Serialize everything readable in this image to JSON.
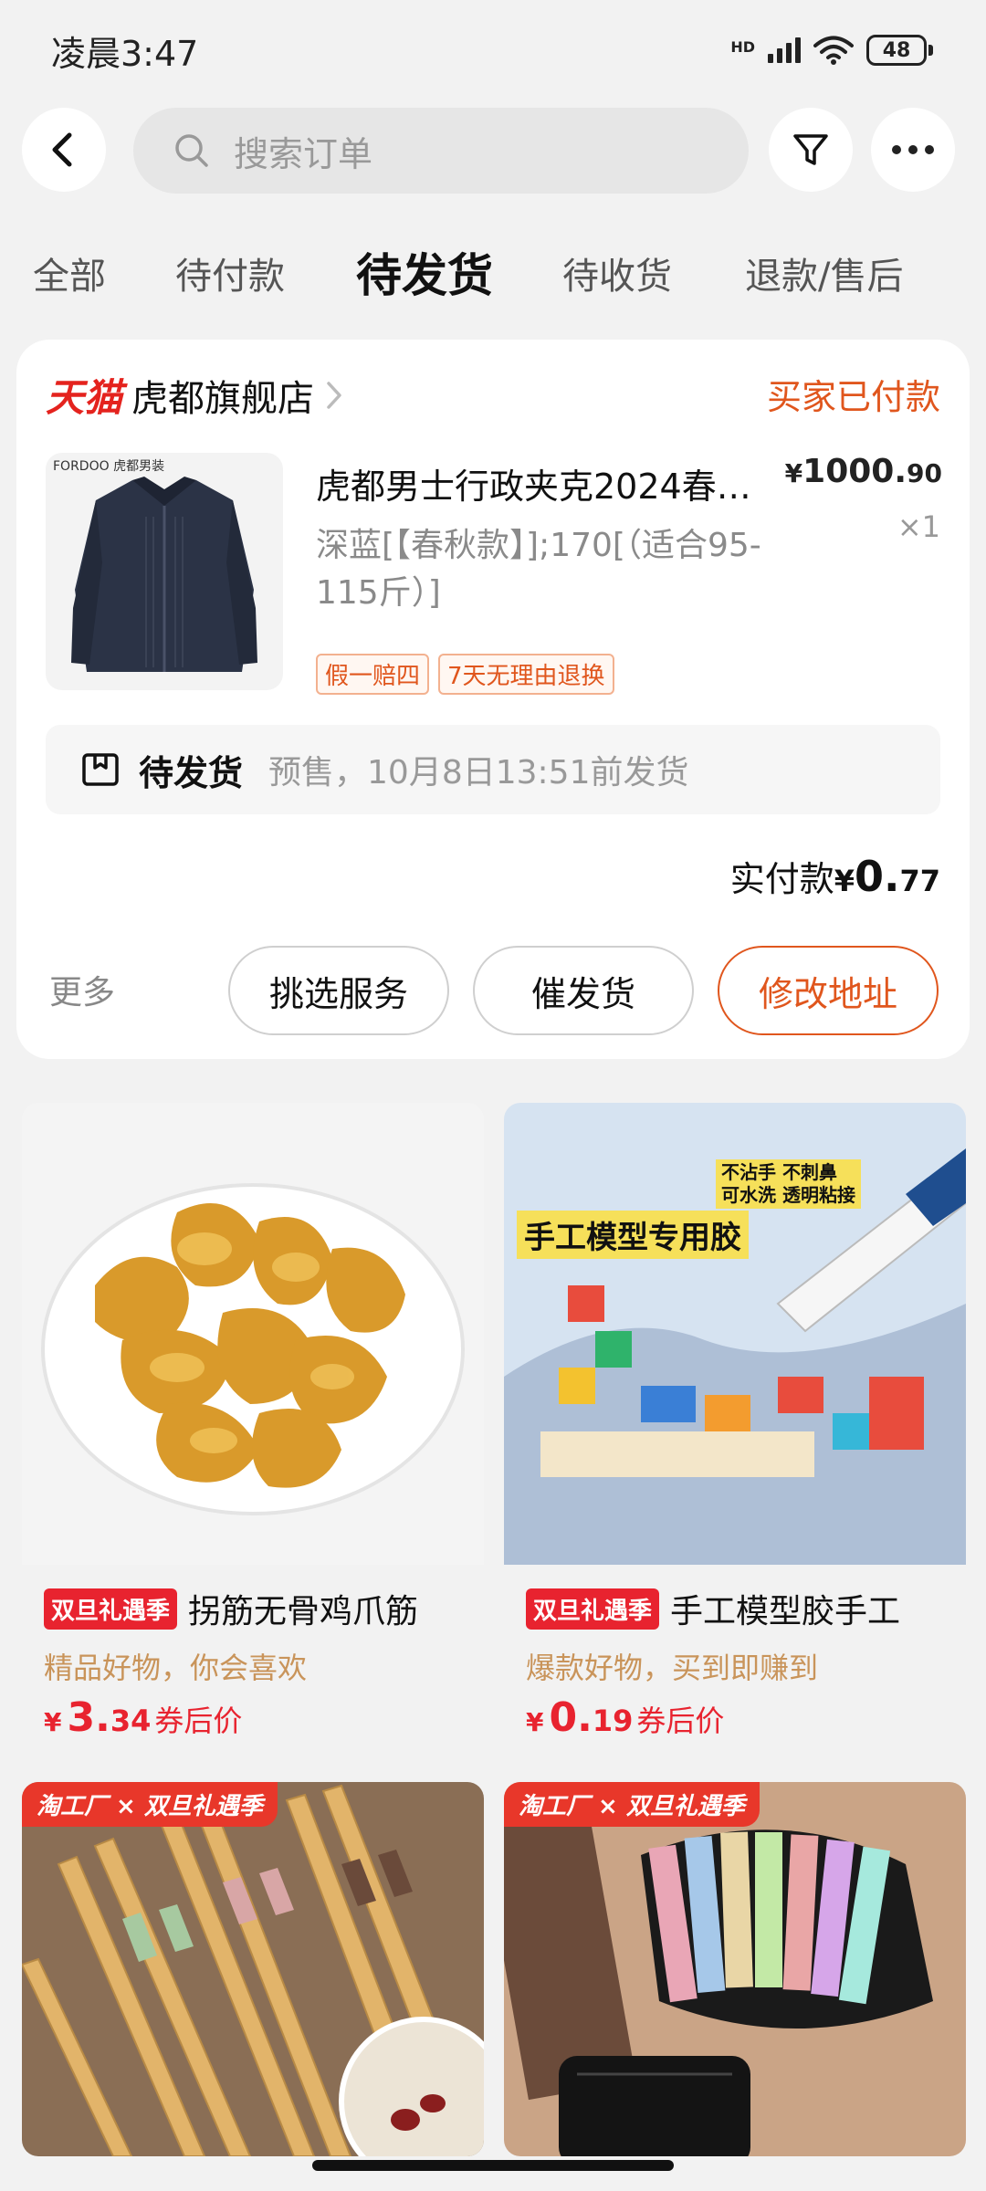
{
  "status_bar": {
    "time": "凌晨3:47",
    "network": "HD",
    "battery": "48"
  },
  "search": {
    "placeholder": "搜索订单"
  },
  "tabs": [
    {
      "label": "全部"
    },
    {
      "label": "待付款"
    },
    {
      "label": "待发货",
      "active": true
    },
    {
      "label": "待收货"
    },
    {
      "label": "退款/售后"
    }
  ],
  "order": {
    "platform": "天猫",
    "store_name": "虎都旗舰店",
    "status": "买家已付款",
    "product_brand": "FORDOO 虎都男装",
    "product_title": "虎都男士行政夹克2024春…",
    "price_currency": "¥",
    "price_integer": "1000.",
    "price_decimal": "90",
    "quantity": "×1",
    "sku": "深蓝[【春秋款】];170[（适合95-115斤）]",
    "service_tags": [
      "假一赔四",
      "7天无理由退换"
    ],
    "shipping_status": "待发货",
    "shipping_note": "预售，10月8日13:51前发货",
    "paid_label": "实付款",
    "paid_currency": "¥",
    "paid_integer": "0.",
    "paid_decimal": "77",
    "more_label": "更多",
    "actions": [
      "挑选服务",
      "催发货",
      "修改地址"
    ]
  },
  "recommendations": [
    {
      "badge": "双旦礼遇季",
      "title": "拐筋无骨鸡爪筋",
      "subtitle": "精品好物，你会喜欢",
      "currency": "¥",
      "price_integer": "3.",
      "price_decimal": "34",
      "price_suffix": "券后价"
    },
    {
      "badge": "双旦礼遇季",
      "title": "手工模型胶手工",
      "subtitle": "爆款好物，买到即赚到",
      "currency": "¥",
      "price_integer": "0.",
      "price_decimal": "19",
      "price_suffix": "券后价",
      "image_text": {
        "headline": "手工模型专用胶",
        "features_1": "不沾手 不刺鼻",
        "features_2": "可水洗 透明粘接"
      }
    },
    {
      "banner": "淘工厂 × 双旦礼遇季"
    },
    {
      "banner": "淘工厂 × 双旦礼遇季"
    }
  ]
}
